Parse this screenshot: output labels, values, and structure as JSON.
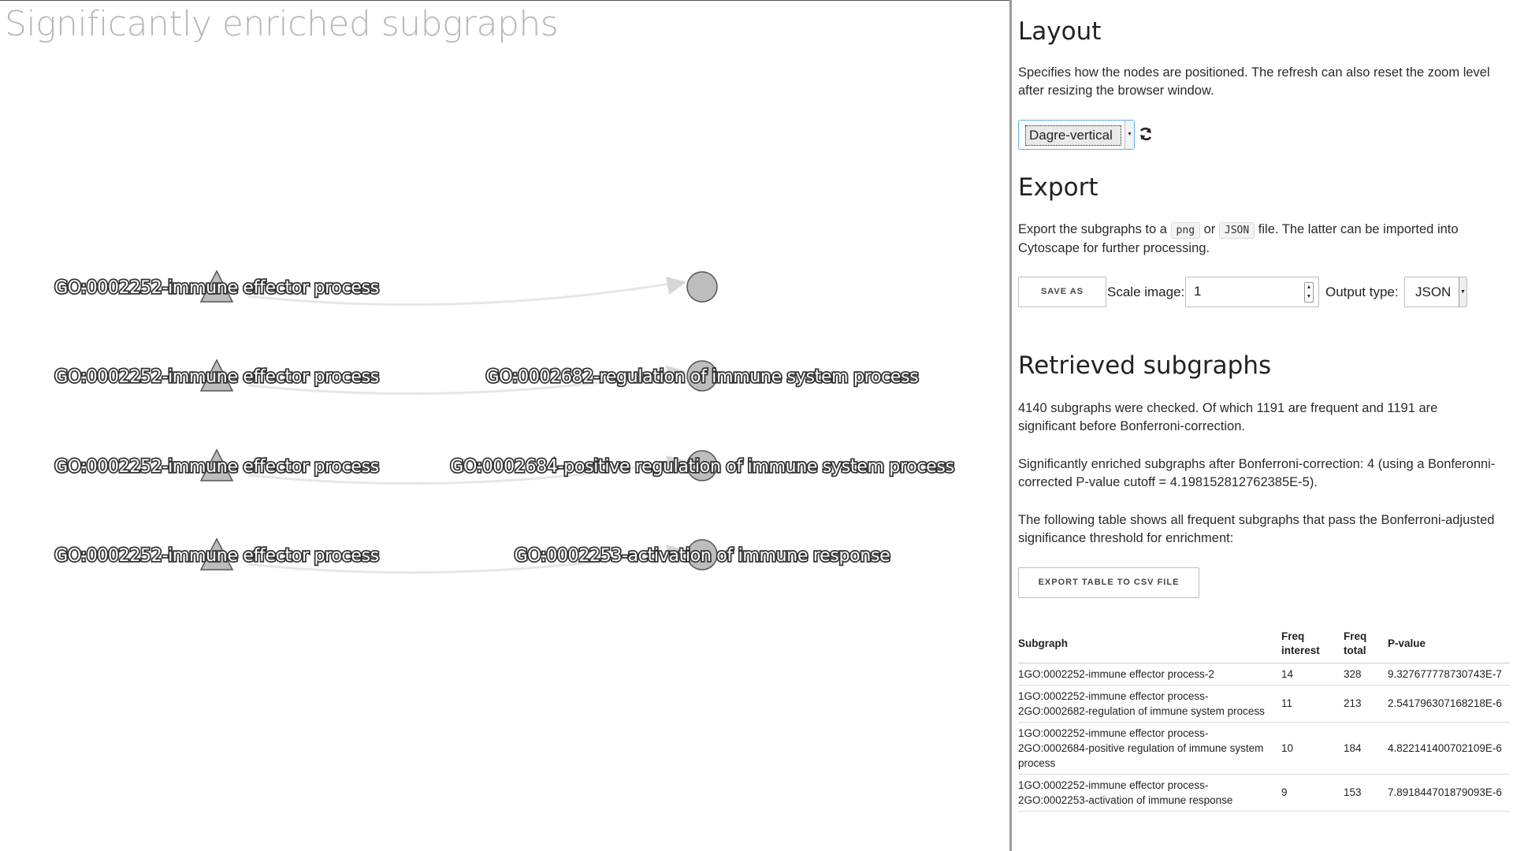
{
  "graph": {
    "title": "Significantly enriched subgraphs",
    "rows": [
      {
        "source": "GO:0002252-immune effector process",
        "target": ""
      },
      {
        "source": "GO:0002252-immune effector process",
        "target": "GO:0002682-regulation of immune system process"
      },
      {
        "source": "GO:0002252-immune effector process",
        "target": "GO:0002684-positive regulation of immune system process"
      },
      {
        "source": "GO:0002252-immune effector process",
        "target": "GO:0002253-activation of immune response"
      }
    ]
  },
  "layout": {
    "heading": "Layout",
    "description": "Specifies how the nodes are positioned. The refresh can also reset the zoom level after resizing the browser window.",
    "selected": "Dagre-vertical"
  },
  "export": {
    "heading": "Export",
    "text_before": "Export the subgraphs to a",
    "code_png": "png",
    "text_or": "or",
    "code_json": "JSON",
    "text_after": "file. The latter can be imported into Cytoscape for further processing.",
    "save_as_label": "SAVE AS",
    "scale_label": "Scale image:",
    "scale_value": "1",
    "output_type_label": "Output type:",
    "output_type_value": "JSON"
  },
  "retrieved": {
    "heading": "Retrieved subgraphs",
    "summary": "4140 subgraphs were checked. Of which 1191 are frequent and 1191 are significant before Bonferroni-correction.",
    "bonferroni": "Significantly enriched subgraphs after Bonferroni-correction: 4 (using a Bonferonni-corrected P-value cutoff = 4.198152812762385E-5).",
    "table_intro": "The following table shows all frequent subgraphs that pass the Bonferroni-adjusted significance threshold for enrichment:",
    "export_csv_label": "EXPORT TABLE TO CSV FILE",
    "columns": [
      "Subgraph",
      "Freq interest",
      "Freq total",
      "P-value"
    ],
    "rows": [
      {
        "subgraph": "1GO:0002252-immune effector process-2",
        "freq_interest": "14",
        "freq_total": "328",
        "p_value": "9.327677778730743E-7"
      },
      {
        "subgraph": "1GO:0002252-immune effector process-2GO:0002682-regulation of immune system process",
        "freq_interest": "11",
        "freq_total": "213",
        "p_value": "2.541796307168218E-6"
      },
      {
        "subgraph": "1GO:0002252-immune effector process-2GO:0002684-positive regulation of immune system process",
        "freq_interest": "10",
        "freq_total": "184",
        "p_value": "4.822141400702109E-6"
      },
      {
        "subgraph": "1GO:0002252-immune effector process-2GO:0002253-activation of immune response",
        "freq_interest": "9",
        "freq_total": "153",
        "p_value": "7.891844701879093E-6"
      }
    ]
  },
  "colors": {
    "node_fill": "#bdbdbd",
    "node_stroke": "#555555",
    "edge": "#e6e6e6",
    "focus": "#5bb1e0"
  },
  "icons": {
    "refresh": "refresh-icon"
  }
}
